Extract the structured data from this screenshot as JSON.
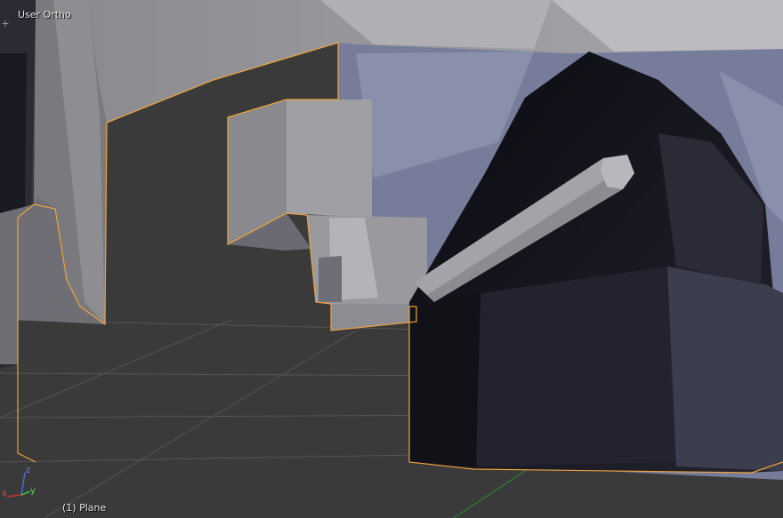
{
  "viewport": {
    "view_label": "User Ortho",
    "object_label": "(1) Plane",
    "region_toggle": "+",
    "colors": {
      "background": "#3a3a3a",
      "selection_outline": "#f0a33a",
      "grid_line": "#555555",
      "y_axis_line": "#2e8b2e",
      "mesh_light": "#9c9ca8",
      "mesh_shadow": "#15151c"
    }
  },
  "gizmo": {
    "x_label": "x",
    "y_label": "y",
    "z_label": "z",
    "x_color": "#d03030",
    "y_color": "#3cc03c",
    "z_color": "#4a6ad8"
  },
  "icons": [
    "region-corner-icon",
    "axis-gizmo-icon"
  ]
}
